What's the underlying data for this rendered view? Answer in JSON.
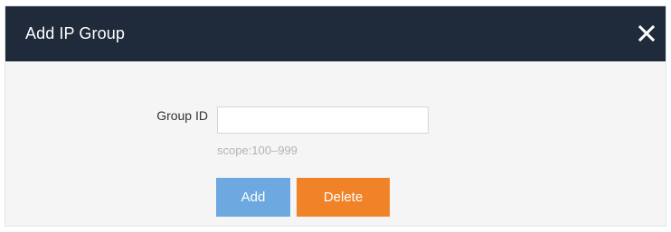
{
  "dialog": {
    "title": "Add IP Group",
    "close_icon": "close-icon"
  },
  "form": {
    "group_id_label": "Group ID",
    "group_id_value": "",
    "group_id_placeholder": "",
    "hint": "scope:100–999"
  },
  "buttons": {
    "add_label": "Add",
    "delete_label": "Delete"
  },
  "colors": {
    "header_bg": "#1f2a3a",
    "add_button": "#6ea8e0",
    "delete_button": "#f08327",
    "hint_text": "#b4b4b4"
  }
}
